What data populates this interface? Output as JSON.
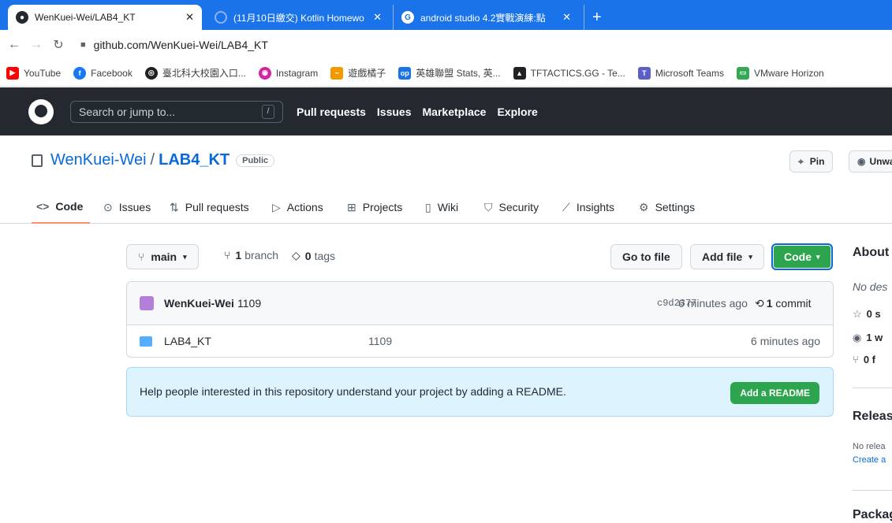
{
  "browser": {
    "tabs": [
      {
        "title": "WenKuei-Wei/LAB4_KT",
        "active": true,
        "icon": "github-icon"
      },
      {
        "title": "(11月10日繳交) Kotlin Homewo",
        "active": false,
        "icon": "loading-icon"
      },
      {
        "title": "android studio 4.2實戰演練:點",
        "active": false,
        "icon": "google-icon"
      }
    ],
    "new_tab": "+",
    "url": "github.com/WenKuei-Wei/LAB4_KT",
    "bookmarks": [
      {
        "label": "YouTube",
        "color": "#ff0000"
      },
      {
        "label": "Facebook",
        "color": "#1877f2"
      },
      {
        "label": "臺北科大校園入口...",
        "color": "#202124"
      },
      {
        "label": "Instagram",
        "color": "#d6249f"
      },
      {
        "label": "遊戲橘子",
        "color": "#f29900"
      },
      {
        "label": "英雄聯盟 Stats, 英...",
        "color": "#1a73e8"
      },
      {
        "label": "TFTACTICS.GG - Te...",
        "color": "#202124"
      },
      {
        "label": "Microsoft Teams",
        "color": "#5b5fc7"
      },
      {
        "label": "VMware Horizon",
        "color": "#34a853"
      }
    ]
  },
  "github": {
    "search_placeholder": "Search or jump to...",
    "search_key": "/",
    "nav": [
      "Pull requests",
      "Issues",
      "Marketplace",
      "Explore"
    ]
  },
  "repo": {
    "owner": "WenKuei-Wei",
    "separator": "/",
    "name": "LAB4_KT",
    "visibility": "Public",
    "pin_label": "Pin",
    "watch_label": "Unwatch",
    "tabs": [
      "Code",
      "Issues",
      "Pull requests",
      "Actions",
      "Projects",
      "Wiki",
      "Security",
      "Insights",
      "Settings"
    ],
    "branch": "main",
    "branch_count": "1",
    "branch_word": "branch",
    "tag_count": "0",
    "tag_word": "tags",
    "goto_file": "Go to file",
    "add_file": "Add file",
    "code_btn": "Code",
    "commit": {
      "author": "WenKuei-Wei",
      "message": "1109",
      "sha": "c9d2377",
      "ago": "6 minutes ago",
      "count": "1",
      "count_word": "commit"
    },
    "files": [
      {
        "name": "LAB4_KT",
        "message": "1109",
        "ago": "6 minutes ago"
      }
    ],
    "readme_prompt": "Help people interested in this repository understand your project by adding a README.",
    "readme_btn": "Add a README"
  },
  "sidebar": {
    "about": "About",
    "about_desc": "No des",
    "stars": "0 s",
    "watchers": "1 w",
    "forks": "0 f",
    "releases": "Releas",
    "no_releases": "No relea",
    "create_release": "Create a",
    "packages": "Packag"
  }
}
